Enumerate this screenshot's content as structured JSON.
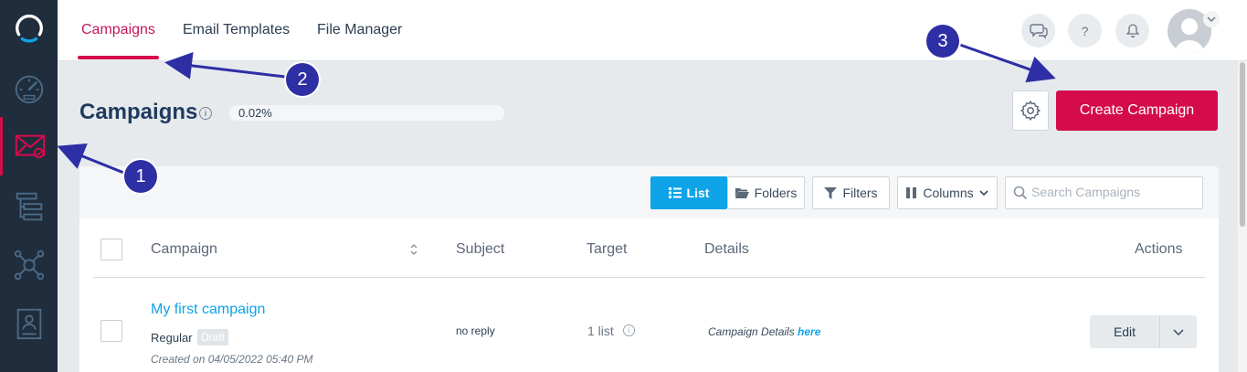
{
  "sidebar": {
    "items": [
      {
        "icon": "logo-ring-icon"
      },
      {
        "icon": "dashboard-gauge-icon"
      },
      {
        "icon": "campaign-mail-icon",
        "active": true
      },
      {
        "icon": "automation-flow-icon"
      },
      {
        "icon": "network-hub-icon"
      },
      {
        "icon": "contacts-card-icon"
      }
    ]
  },
  "topbar": {
    "tabs": [
      {
        "label": "Campaigns",
        "active": true
      },
      {
        "label": "Email Templates"
      },
      {
        "label": "File Manager"
      }
    ],
    "icons": [
      "chat-icon",
      "help-icon",
      "bell-icon"
    ],
    "help_glyph": "?"
  },
  "header": {
    "title": "Campaigns",
    "info_glyph": "i",
    "progress_label": "0.02%",
    "progress_value": 0.02,
    "create_label": "Create Campaign"
  },
  "toolbar": {
    "list_label": "List",
    "folders_label": "Folders",
    "filters_label": "Filters",
    "columns_label": "Columns",
    "search_placeholder": "Search Campaigns"
  },
  "table": {
    "headers": {
      "campaign": "Campaign",
      "subject": "Subject",
      "target": "Target",
      "details": "Details",
      "actions": "Actions"
    },
    "rows": [
      {
        "name": "My first campaign",
        "type": "Regular",
        "status": "Draft",
        "created": "Created on 04/05/2022 05:40 PM",
        "subject": "no reply",
        "target": "1 list",
        "details_prefix": "Campaign Details ",
        "details_link": "here",
        "action_label": "Edit"
      }
    ]
  },
  "annotations": {
    "marker_1": "1",
    "marker_2": "2",
    "marker_3": "3"
  },
  "colors": {
    "sidebar_bg": "#1f2d3d",
    "accent": "#d50c4c",
    "link": "#0fa3e8",
    "annotation": "#2e2ea5"
  }
}
